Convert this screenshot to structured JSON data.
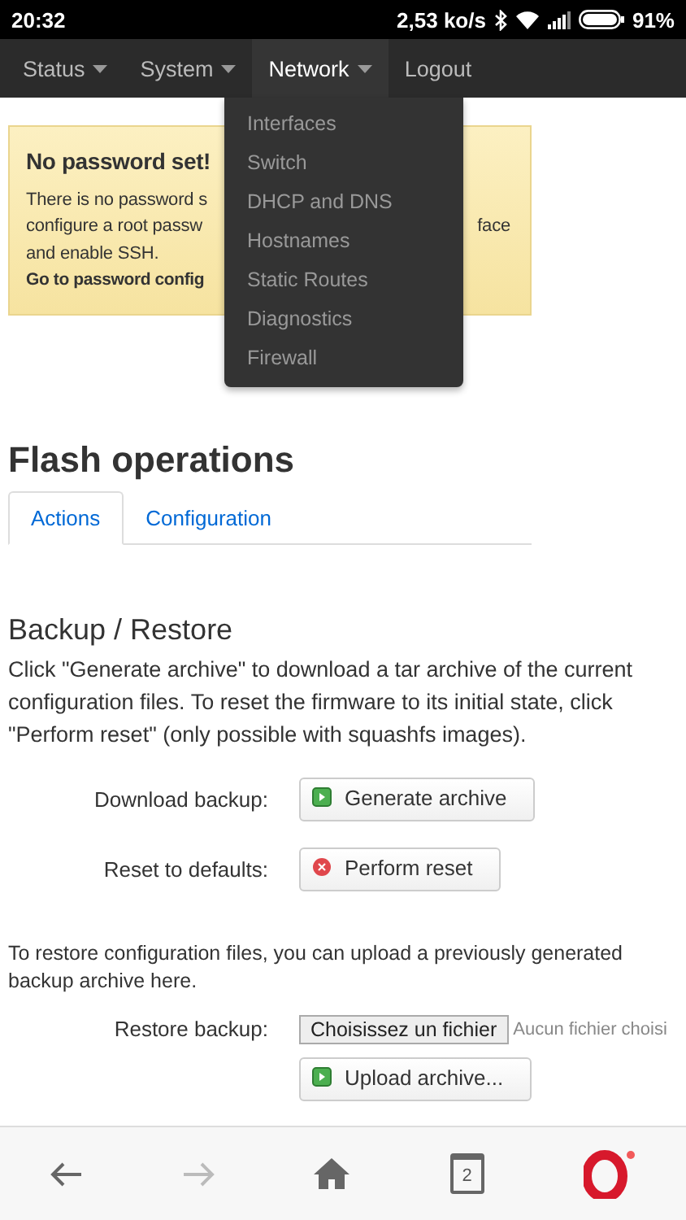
{
  "status_bar": {
    "time": "20:32",
    "speed": "2,53 ko/s",
    "battery": "91%"
  },
  "nav": {
    "items": [
      {
        "label": "Status",
        "selected": false,
        "dropdown": true
      },
      {
        "label": "System",
        "selected": false,
        "dropdown": true
      },
      {
        "label": "Network",
        "selected": true,
        "dropdown": true
      },
      {
        "label": "Logout",
        "selected": false,
        "dropdown": false
      }
    ],
    "menu": [
      "Interfaces",
      "Switch",
      "DHCP and DNS",
      "Hostnames",
      "Static Routes",
      "Diagnostics",
      "Firewall"
    ]
  },
  "alert": {
    "title": "No password set!",
    "lines": [
      {
        "left": "There is no password s"
      },
      {
        "left": "configure a root passw",
        "right": "face"
      },
      {
        "left": "and enable SSH."
      }
    ],
    "link": "Go to password config"
  },
  "page_title": "Flash operations",
  "tabs": [
    {
      "label": "Actions",
      "selected": true
    },
    {
      "label": "Configuration",
      "selected": false
    }
  ],
  "section": {
    "title": "Backup / Restore",
    "description": "Click \"Generate archive\" to download a tar archive of the current configuration files. To reset the firmware to its initial state, click \"Perform reset\" (only possible with squashfs images).",
    "rows": [
      {
        "label": "Download backup:",
        "button": "Generate archive",
        "kind": "go"
      },
      {
        "label": "Reset to defaults:",
        "button": "Perform reset",
        "kind": "reset"
      }
    ],
    "restore_text": "To restore configuration files, you can upload a previously generated backup archive here.",
    "restore_label": "Restore backup:",
    "file_button": "Choisissez un fichier",
    "file_status": "Aucun fichier choisi",
    "upload_button": "Upload archive..."
  },
  "browser_bar": {
    "tabs_count": "2"
  }
}
